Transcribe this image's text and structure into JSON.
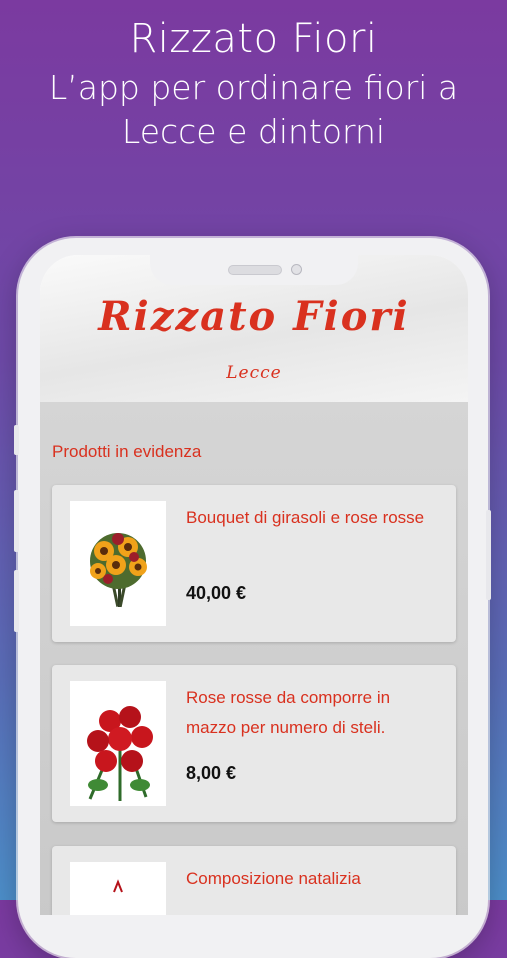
{
  "promo": {
    "title": "Rizzato Fiori",
    "subtitle": "L’app per ordinare fiori a Lecce e dintorni"
  },
  "app": {
    "logo_title": "Rizzato Fiori",
    "logo_sub": "Lecce",
    "section_title": "Prodotti in evidenza",
    "brand_color": "#d9311f",
    "products": [
      {
        "name": "Bouquet di girasoli e rose rosse",
        "price": "40,00 €",
        "image": "sunflower-bouquet"
      },
      {
        "name": "Rose rosse da comporre in mazzo per numero di steli.",
        "price": "8,00 €",
        "image": "red-roses"
      },
      {
        "name": "Composizione natalizia",
        "price": "",
        "image": "christmas-arrangement"
      }
    ]
  }
}
